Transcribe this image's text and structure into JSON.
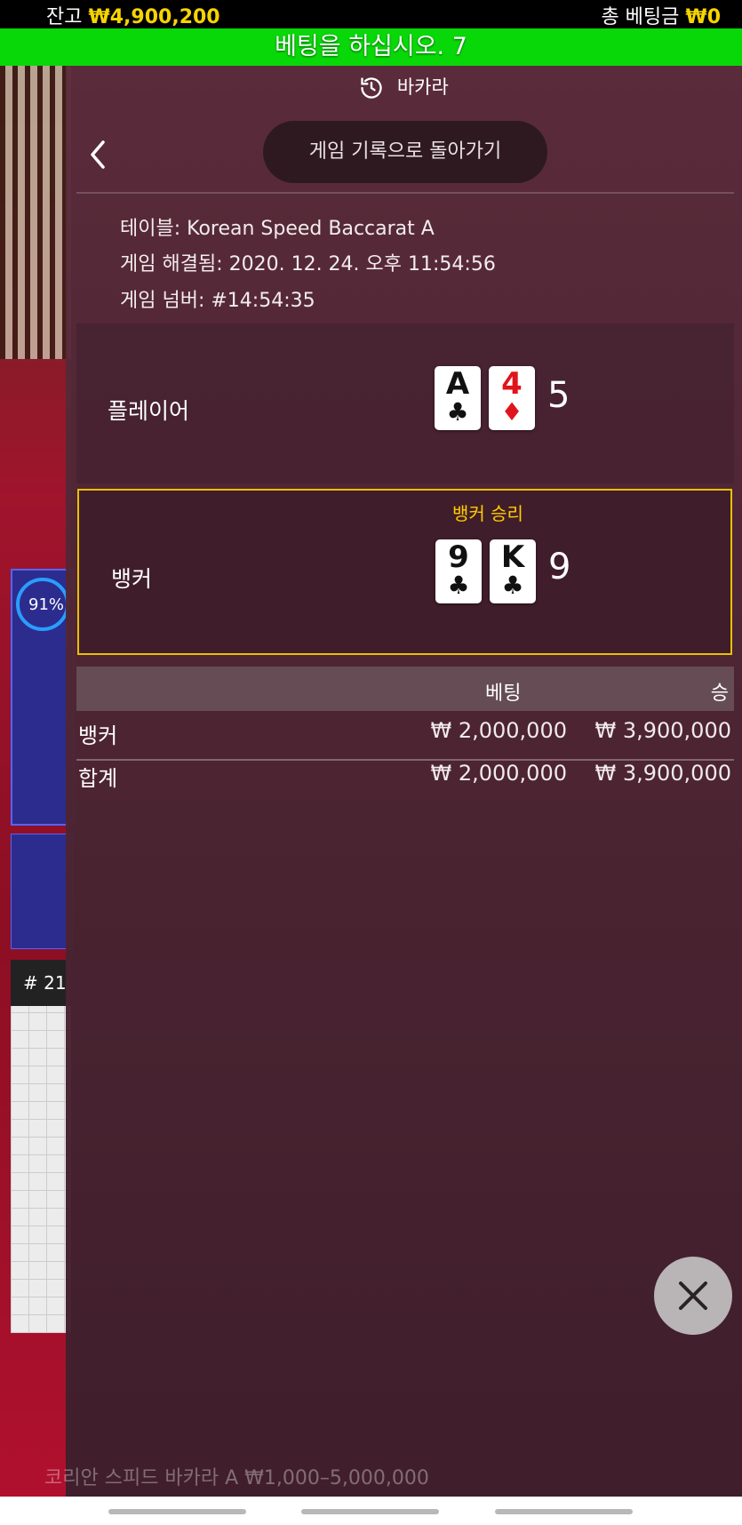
{
  "top_bar": {
    "balance_label": "잔고",
    "balance_value": "₩4,900,200",
    "total_bet_label": "총 베팅금",
    "total_bet_value": "₩0"
  },
  "status_banner": "베팅을 하십시오. 7",
  "history_panel": {
    "header_title": "바카라",
    "back_to_history_label": "게임 기록으로 돌아가기",
    "table_info": "테이블: Korean Speed Baccarat A",
    "resolved_info": "게임 해결됨: 2020. 12. 24. 오후 11:54:56",
    "game_number_info": "게임 넘버: #14:54:35",
    "player": {
      "label": "플레이어",
      "cards": [
        {
          "rank": "A",
          "suit": "♣",
          "color": "black"
        },
        {
          "rank": "4",
          "suit": "♦",
          "color": "red"
        }
      ],
      "score": "5"
    },
    "banker": {
      "label": "뱅커",
      "result_label": "뱅커 승리",
      "cards": [
        {
          "rank": "9",
          "suit": "♣",
          "color": "black"
        },
        {
          "rank": "K",
          "suit": "♣",
          "color": "black"
        }
      ],
      "score": "9"
    },
    "bets_table": {
      "headers": [
        "베팅",
        "승"
      ],
      "rows": [
        {
          "name": "뱅커",
          "bet": "₩ 2,000,000",
          "win": "₩ 3,900,000"
        }
      ],
      "total": {
        "name": "합계",
        "bet": "₩ 2,000,000",
        "win": "₩ 3,900,000"
      }
    }
  },
  "background": {
    "timer_text": "91%",
    "roadmap_header": "# 21",
    "footer_text": "코리안 스피드 바카라 A ₩1,000–5,000,000"
  },
  "colors": {
    "accent_gold": "#f6d400",
    "banner_green": "#08d808",
    "win_border": "#e9c100"
  }
}
